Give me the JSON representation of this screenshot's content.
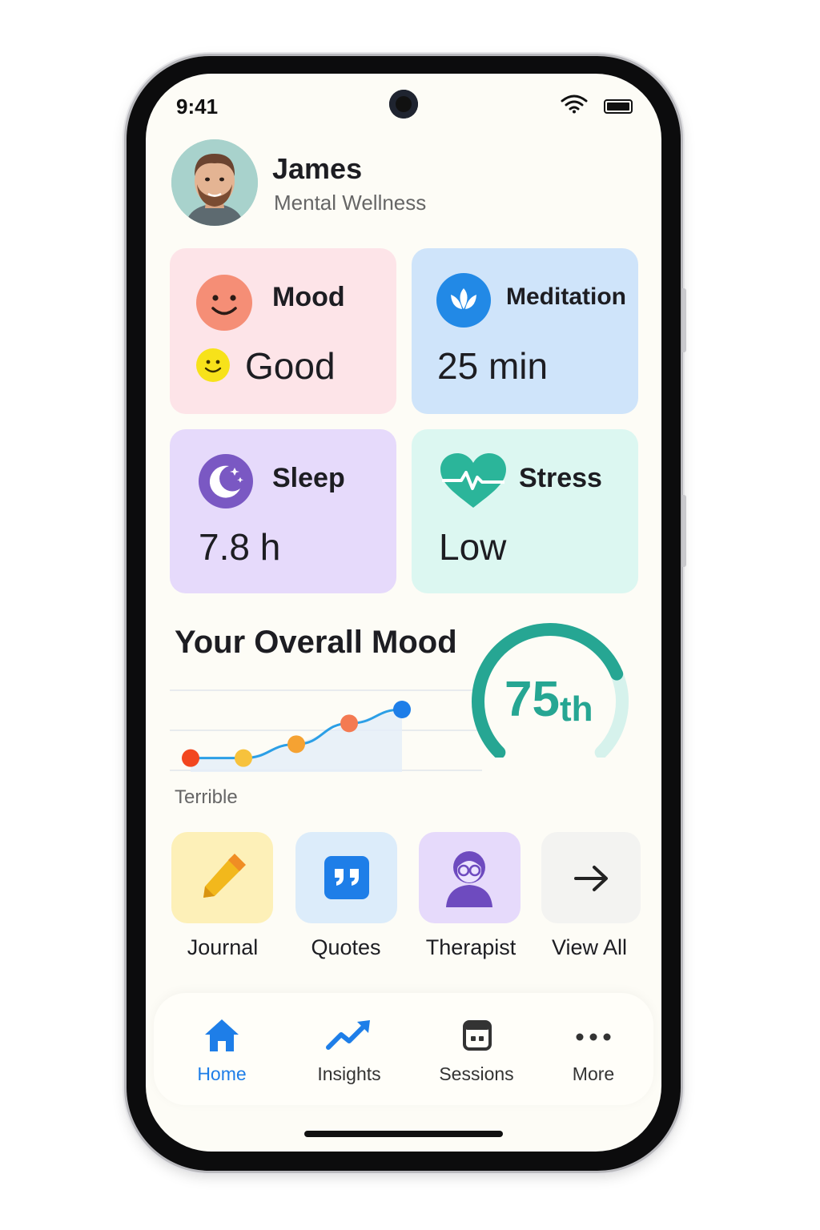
{
  "status_bar": {
    "time": "9:41"
  },
  "profile": {
    "name": "James",
    "subtitle": "Mental Wellness"
  },
  "cards": {
    "mood": {
      "title": "Mood",
      "value": "Good"
    },
    "meditation": {
      "title": "Meditation",
      "value": "25 min"
    },
    "sleep": {
      "title": "Sleep",
      "value": "7.8 h"
    },
    "stress": {
      "title": "Stress",
      "value": "Low"
    }
  },
  "overall_mood": {
    "title": "Your Overall Mood",
    "low_label": "Terrible",
    "percentile_number": "75",
    "percentile_suffix": "th",
    "gauge_fraction": 0.75
  },
  "chart_data": {
    "type": "line",
    "values": [
      1,
      1,
      2,
      3.5,
      4.5
    ],
    "point_colors": [
      "#f2461f",
      "#f7c23c",
      "#f5a232",
      "#f47a52",
      "#1e7ee8"
    ],
    "ylim": [
      0,
      6
    ],
    "grid": true
  },
  "quick_actions": [
    {
      "label": "Journal",
      "icon": "pencil-icon",
      "bg": "#fdf0b8"
    },
    {
      "label": "Quotes",
      "icon": "quote-icon",
      "bg": "#dcecfa"
    },
    {
      "label": "Therapist",
      "icon": "therapist-icon",
      "bg": "#e6dafb"
    },
    {
      "label": "View All",
      "icon": "arrow-right-icon",
      "bg": "#f3f3f1"
    }
  ],
  "bottom_nav": [
    {
      "label": "Home",
      "icon": "home-icon",
      "active": true
    },
    {
      "label": "Insights",
      "icon": "trend-up-icon",
      "active": false
    },
    {
      "label": "Sessions",
      "icon": "calendar-icon",
      "active": false
    },
    {
      "label": "More",
      "icon": "more-icon",
      "active": false
    }
  ],
  "colors": {
    "accent": "#1e7ee8",
    "teal": "#26a693",
    "mood_card": "#fde4e8",
    "meditation_card": "#cfe4fa",
    "sleep_card": "#e6dafb",
    "stress_card": "#dcf7f1"
  }
}
